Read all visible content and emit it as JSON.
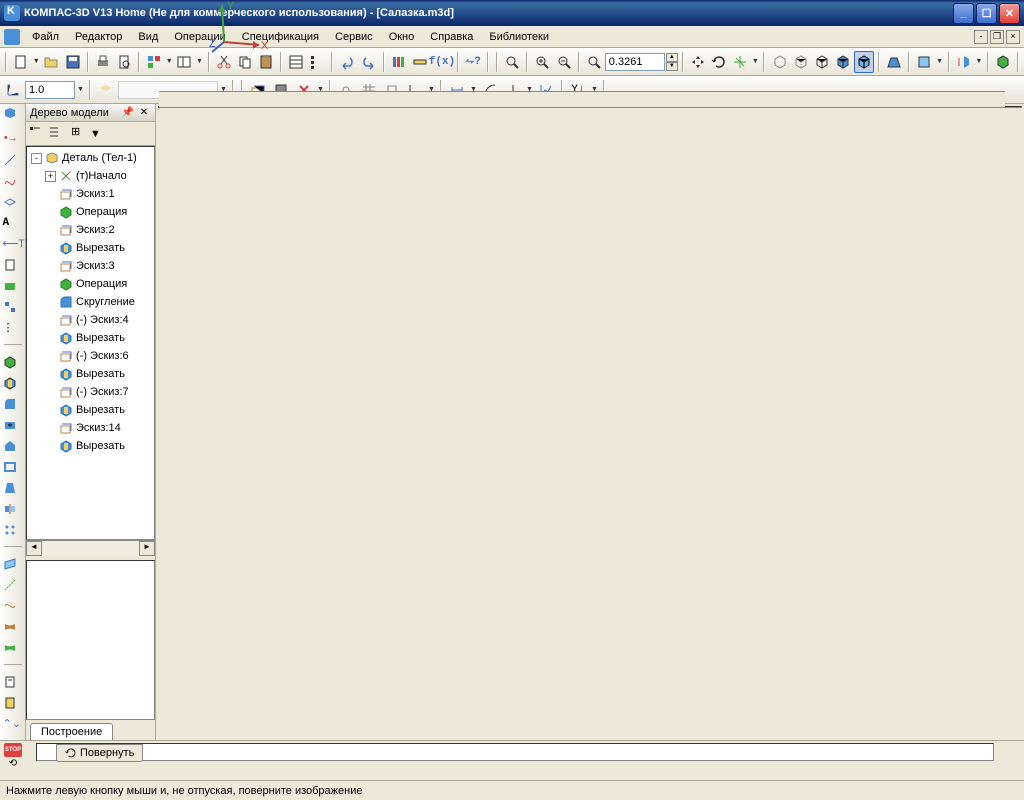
{
  "titlebar": {
    "title": "КОМПАС-3D V13 Home (Не для коммерческого использования) - [Салазка.m3d]"
  },
  "menu": {
    "file": "Файл",
    "editor": "Редактор",
    "view": "Вид",
    "operations": "Операции",
    "spec": "Спецификация",
    "service": "Сервис",
    "window": "Окно",
    "help": "Справка",
    "libs": "Библиотеки"
  },
  "toolbar": {
    "zoom_value": "0.3261",
    "line_weight": "1.0"
  },
  "panel": {
    "title": "Дерево модели",
    "tree": {
      "root": "Деталь (Тел-1)",
      "items": [
        {
          "label": "(т)Начало",
          "icon": "origin"
        },
        {
          "label": "Эскиз:1",
          "icon": "sketch"
        },
        {
          "label": "Операция",
          "icon": "extrude"
        },
        {
          "label": "Эскиз:2",
          "icon": "sketch"
        },
        {
          "label": "Вырезать",
          "icon": "cut"
        },
        {
          "label": "Эскиз:3",
          "icon": "sketch"
        },
        {
          "label": "Операция",
          "icon": "extrude"
        },
        {
          "label": "Скругление",
          "icon": "fillet"
        },
        {
          "label": "(-) Эскиз:4",
          "icon": "sketch"
        },
        {
          "label": "Вырезать",
          "icon": "cut"
        },
        {
          "label": "(-) Эскиз:6",
          "icon": "sketch"
        },
        {
          "label": "Вырезать",
          "icon": "cut"
        },
        {
          "label": "(-) Эскиз:7",
          "icon": "sketch"
        },
        {
          "label": "Вырезать",
          "icon": "cut"
        },
        {
          "label": "Эскиз:14",
          "icon": "sketch"
        },
        {
          "label": "Вырезать",
          "icon": "cut"
        }
      ]
    },
    "bottom_tab": "Построение"
  },
  "axis": {
    "x": "X",
    "y": "Y",
    "z": "Z"
  },
  "command_tab": "Повернуть",
  "stop": "STOP",
  "statusbar": {
    "hint": "Нажмите левую кнопку мыши и, не отпуская, поверните изображение"
  }
}
